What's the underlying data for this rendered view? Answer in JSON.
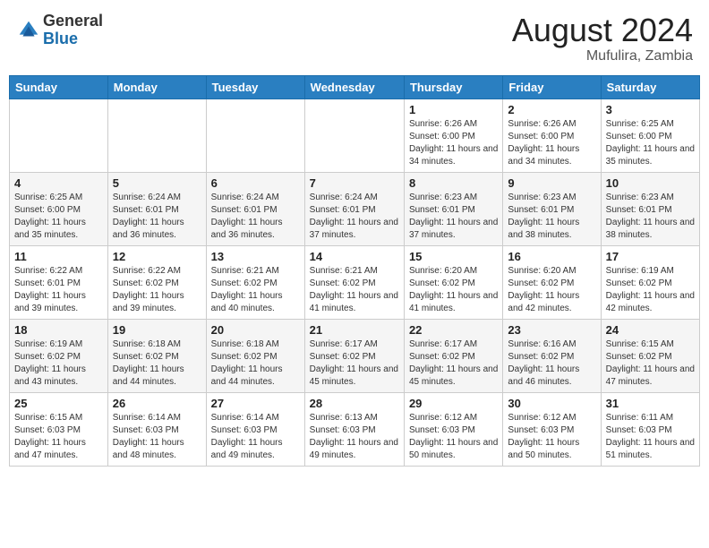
{
  "header": {
    "logo_general": "General",
    "logo_blue": "Blue",
    "month_year": "August 2024",
    "location": "Mufulira, Zambia"
  },
  "days_header": [
    "Sunday",
    "Monday",
    "Tuesday",
    "Wednesday",
    "Thursday",
    "Friday",
    "Saturday"
  ],
  "weeks": [
    [
      {
        "day": "",
        "info": ""
      },
      {
        "day": "",
        "info": ""
      },
      {
        "day": "",
        "info": ""
      },
      {
        "day": "",
        "info": ""
      },
      {
        "day": "1",
        "info": "Sunrise: 6:26 AM\nSunset: 6:00 PM\nDaylight: 11 hours and 34 minutes."
      },
      {
        "day": "2",
        "info": "Sunrise: 6:26 AM\nSunset: 6:00 PM\nDaylight: 11 hours and 34 minutes."
      },
      {
        "day": "3",
        "info": "Sunrise: 6:25 AM\nSunset: 6:00 PM\nDaylight: 11 hours and 35 minutes."
      }
    ],
    [
      {
        "day": "4",
        "info": "Sunrise: 6:25 AM\nSunset: 6:00 PM\nDaylight: 11 hours and 35 minutes."
      },
      {
        "day": "5",
        "info": "Sunrise: 6:24 AM\nSunset: 6:01 PM\nDaylight: 11 hours and 36 minutes."
      },
      {
        "day": "6",
        "info": "Sunrise: 6:24 AM\nSunset: 6:01 PM\nDaylight: 11 hours and 36 minutes."
      },
      {
        "day": "7",
        "info": "Sunrise: 6:24 AM\nSunset: 6:01 PM\nDaylight: 11 hours and 37 minutes."
      },
      {
        "day": "8",
        "info": "Sunrise: 6:23 AM\nSunset: 6:01 PM\nDaylight: 11 hours and 37 minutes."
      },
      {
        "day": "9",
        "info": "Sunrise: 6:23 AM\nSunset: 6:01 PM\nDaylight: 11 hours and 38 minutes."
      },
      {
        "day": "10",
        "info": "Sunrise: 6:23 AM\nSunset: 6:01 PM\nDaylight: 11 hours and 38 minutes."
      }
    ],
    [
      {
        "day": "11",
        "info": "Sunrise: 6:22 AM\nSunset: 6:01 PM\nDaylight: 11 hours and 39 minutes."
      },
      {
        "day": "12",
        "info": "Sunrise: 6:22 AM\nSunset: 6:02 PM\nDaylight: 11 hours and 39 minutes."
      },
      {
        "day": "13",
        "info": "Sunrise: 6:21 AM\nSunset: 6:02 PM\nDaylight: 11 hours and 40 minutes."
      },
      {
        "day": "14",
        "info": "Sunrise: 6:21 AM\nSunset: 6:02 PM\nDaylight: 11 hours and 41 minutes."
      },
      {
        "day": "15",
        "info": "Sunrise: 6:20 AM\nSunset: 6:02 PM\nDaylight: 11 hours and 41 minutes."
      },
      {
        "day": "16",
        "info": "Sunrise: 6:20 AM\nSunset: 6:02 PM\nDaylight: 11 hours and 42 minutes."
      },
      {
        "day": "17",
        "info": "Sunrise: 6:19 AM\nSunset: 6:02 PM\nDaylight: 11 hours and 42 minutes."
      }
    ],
    [
      {
        "day": "18",
        "info": "Sunrise: 6:19 AM\nSunset: 6:02 PM\nDaylight: 11 hours and 43 minutes."
      },
      {
        "day": "19",
        "info": "Sunrise: 6:18 AM\nSunset: 6:02 PM\nDaylight: 11 hours and 44 minutes."
      },
      {
        "day": "20",
        "info": "Sunrise: 6:18 AM\nSunset: 6:02 PM\nDaylight: 11 hours and 44 minutes."
      },
      {
        "day": "21",
        "info": "Sunrise: 6:17 AM\nSunset: 6:02 PM\nDaylight: 11 hours and 45 minutes."
      },
      {
        "day": "22",
        "info": "Sunrise: 6:17 AM\nSunset: 6:02 PM\nDaylight: 11 hours and 45 minutes."
      },
      {
        "day": "23",
        "info": "Sunrise: 6:16 AM\nSunset: 6:02 PM\nDaylight: 11 hours and 46 minutes."
      },
      {
        "day": "24",
        "info": "Sunrise: 6:15 AM\nSunset: 6:02 PM\nDaylight: 11 hours and 47 minutes."
      }
    ],
    [
      {
        "day": "25",
        "info": "Sunrise: 6:15 AM\nSunset: 6:03 PM\nDaylight: 11 hours and 47 minutes."
      },
      {
        "day": "26",
        "info": "Sunrise: 6:14 AM\nSunset: 6:03 PM\nDaylight: 11 hours and 48 minutes."
      },
      {
        "day": "27",
        "info": "Sunrise: 6:14 AM\nSunset: 6:03 PM\nDaylight: 11 hours and 49 minutes."
      },
      {
        "day": "28",
        "info": "Sunrise: 6:13 AM\nSunset: 6:03 PM\nDaylight: 11 hours and 49 minutes."
      },
      {
        "day": "29",
        "info": "Sunrise: 6:12 AM\nSunset: 6:03 PM\nDaylight: 11 hours and 50 minutes."
      },
      {
        "day": "30",
        "info": "Sunrise: 6:12 AM\nSunset: 6:03 PM\nDaylight: 11 hours and 50 minutes."
      },
      {
        "day": "31",
        "info": "Sunrise: 6:11 AM\nSunset: 6:03 PM\nDaylight: 11 hours and 51 minutes."
      }
    ]
  ]
}
